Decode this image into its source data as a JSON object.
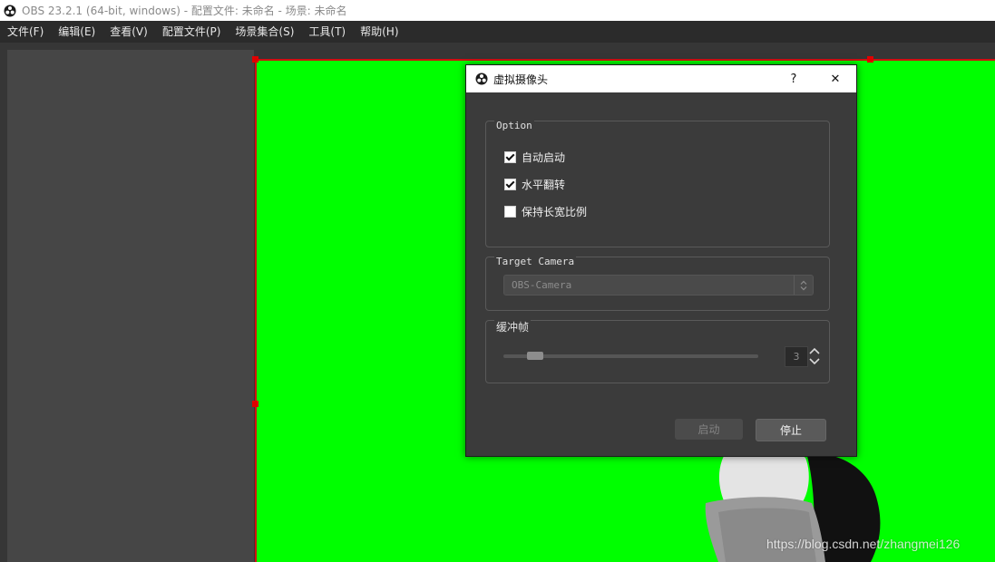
{
  "window": {
    "title": "OBS 23.2.1 (64-bit, windows) - 配置文件: 未命名 - 场景: 未命名"
  },
  "menu": [
    "文件(F)",
    "编辑(E)",
    "查看(V)",
    "配置文件(P)",
    "场景集合(S)",
    "工具(T)",
    "帮助(H)"
  ],
  "dialog": {
    "title": "虚拟摄像头",
    "help": "?",
    "close": "✕",
    "option_group": {
      "label": "Option",
      "items": [
        {
          "label": "自动启动",
          "checked": true
        },
        {
          "label": "水平翻转",
          "checked": true
        },
        {
          "label": "保持长宽比例",
          "checked": false
        }
      ]
    },
    "camera_group": {
      "label": "Target Camera",
      "selected": "OBS-Camera"
    },
    "buffer_group": {
      "label": "缓冲帧",
      "value": "3",
      "slider_fraction": 0.1
    },
    "buttons": {
      "start": "启动",
      "stop": "停止"
    }
  },
  "watermark": "https://blog.csdn.net/zhangmei126",
  "colors": {
    "chroma": "#00ff00",
    "selection": "#d01010",
    "arrow": "#ee1c1c"
  }
}
